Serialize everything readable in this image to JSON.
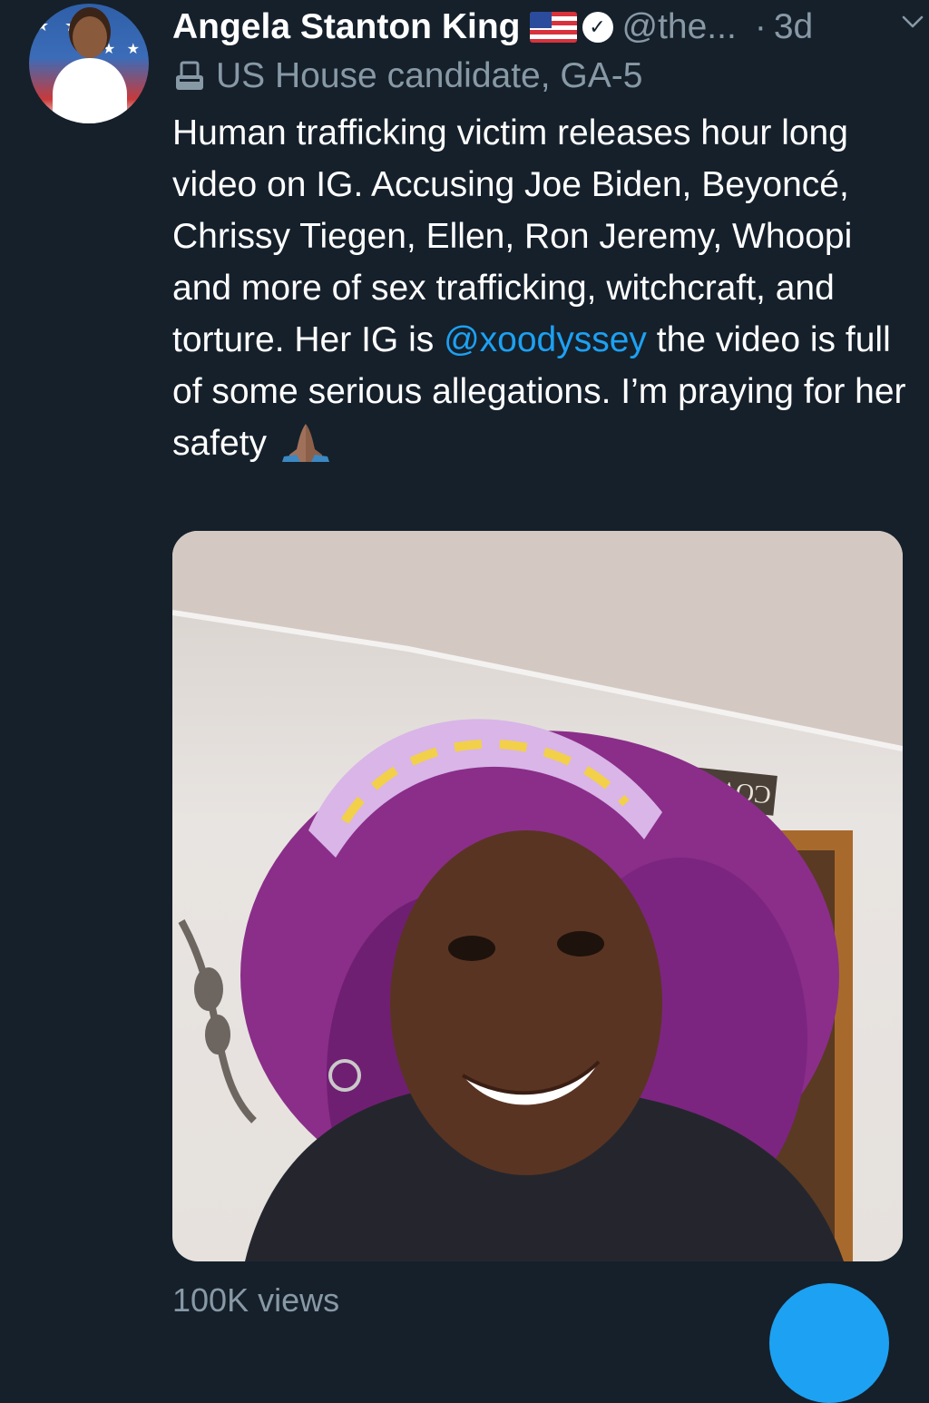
{
  "tweet": {
    "author_name": "Angela Stanton King",
    "handle": "@the...",
    "separator": "·",
    "time": "3d",
    "label": "US House candidate, GA-5",
    "text_before": "Human trafficking victim releases hour long video on IG. Accusing Joe Biden, Beyoncé, Chrissy Tiegen, Ellen, Ron Jeremy, Whoopi and more of sex trafficking, witchcraft, and torture. Her IG is ",
    "mention": "@xoodyssey",
    "text_after": " the video is full of some serious allegations. I’m praying for her safety",
    "media_sign_text": "COWBOYS",
    "views": "100K views"
  },
  "colors": {
    "background": "#15202b",
    "secondary_text": "#8899a6",
    "link": "#1da1f2",
    "accent": "#1da1f2"
  },
  "icons": {
    "verified": "verified-badge-icon",
    "flag": "us-flag-icon",
    "label": "ballot-box-icon",
    "menu": "chevron-down-icon",
    "emoji": "folded-hands-icon"
  }
}
